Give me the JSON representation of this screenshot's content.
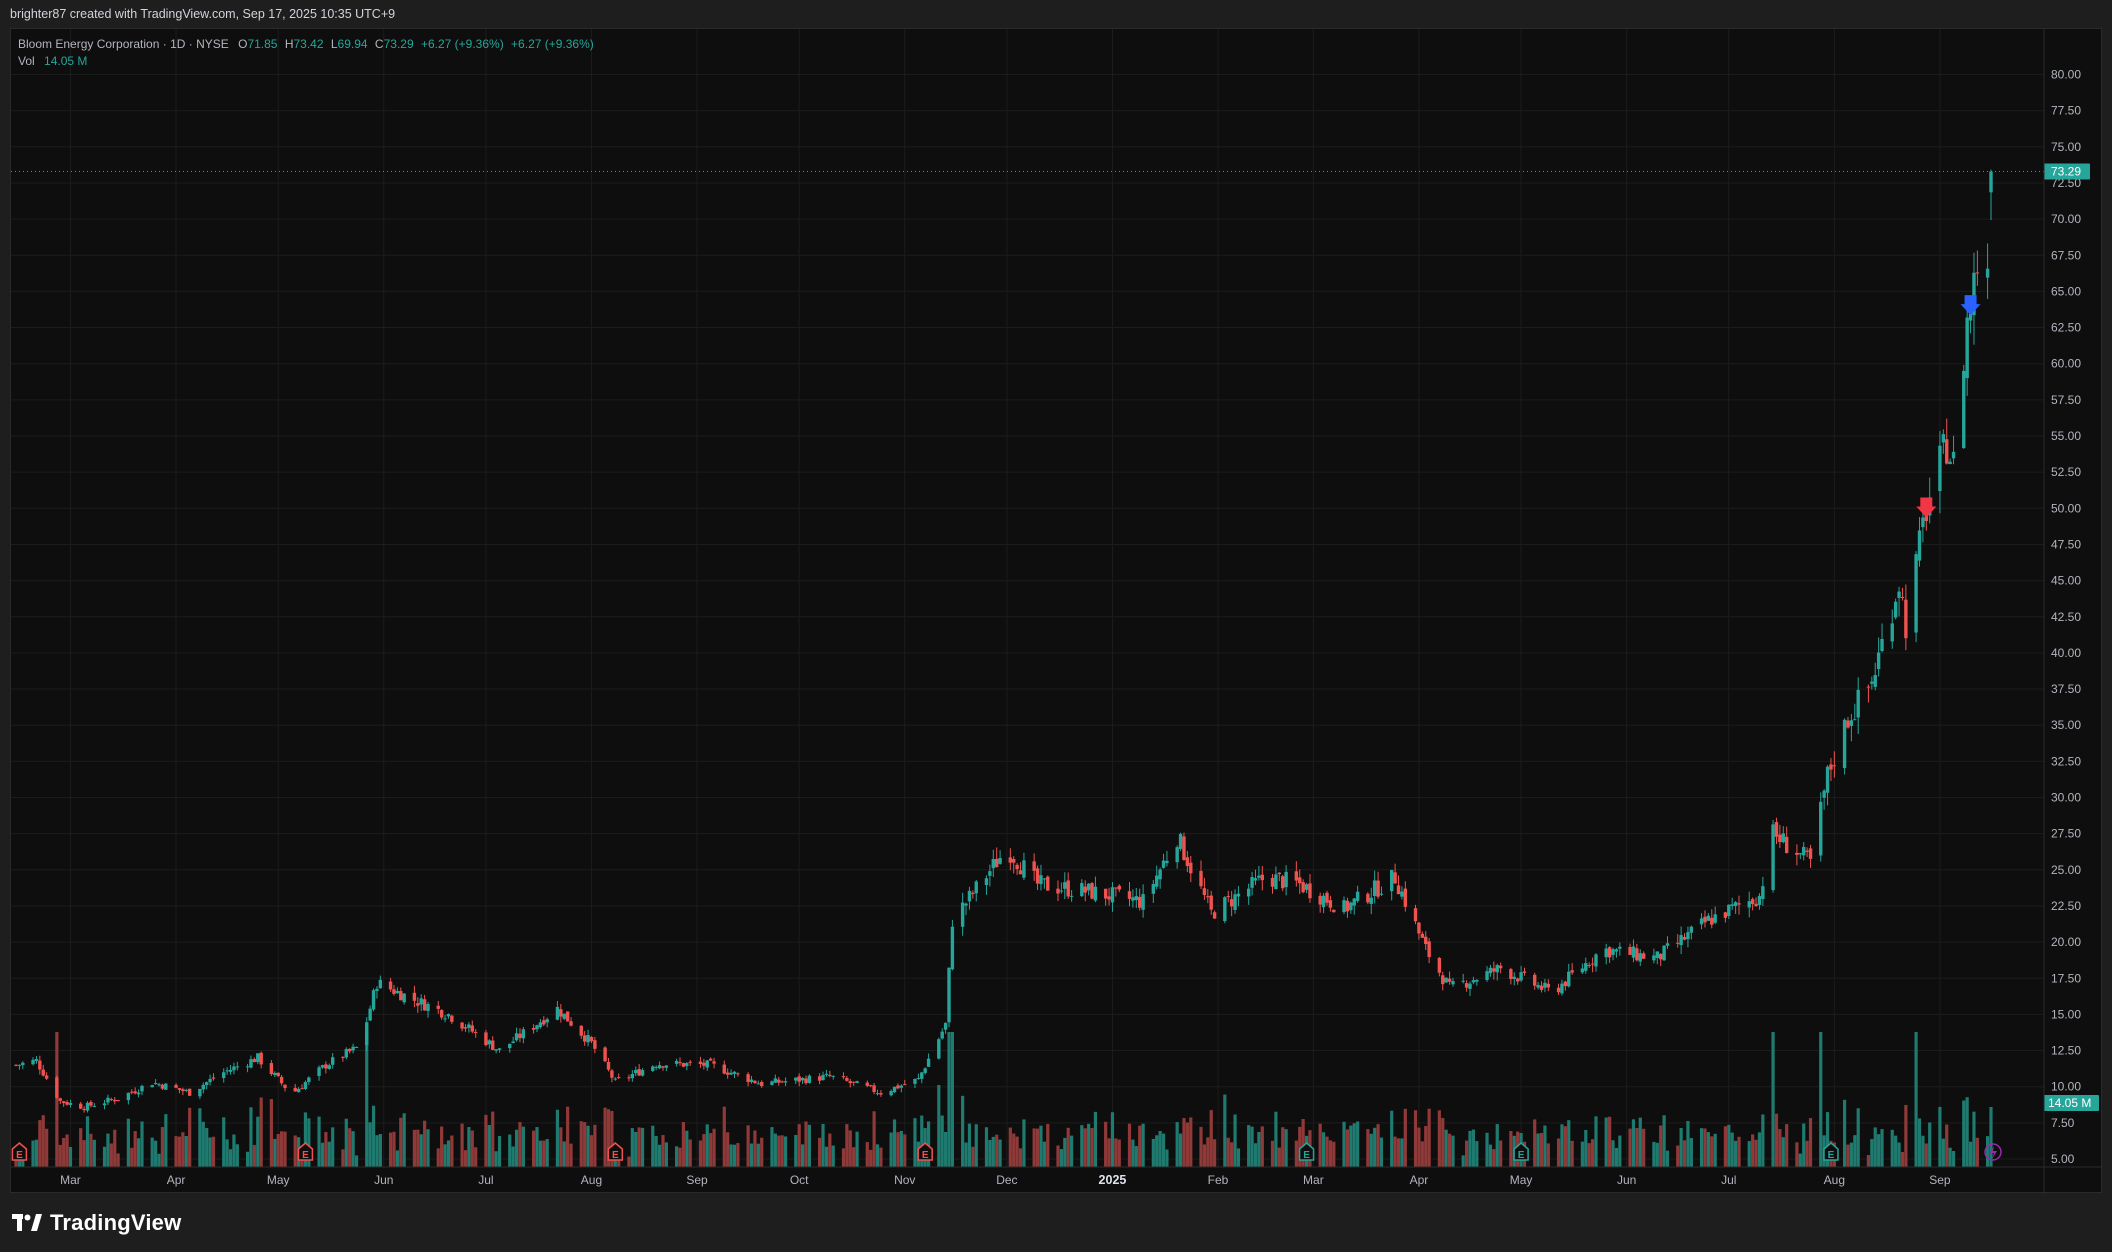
{
  "credit": "brighter87 created with TradingView.com, Sep 17, 2025 10:35 UTC+9",
  "legend": {
    "symbol": "Bloom Energy Corporation · 1D · NYSE",
    "o_label": "O",
    "o_value": "71.85",
    "h_label": "H",
    "h_value": "73.42",
    "l_label": "L",
    "l_value": "69.94",
    "c_label": "C",
    "c_value": "73.29",
    "change": "+6.27 (+9.36%)",
    "change2": "+6.27 (+9.36%)",
    "vol_label": "Vol",
    "vol_value": "14.05 M"
  },
  "logo": "TradingView",
  "colors": {
    "up": "#26a69a",
    "down": "#ef5350",
    "up_volume": "#1f7a6f",
    "down_volume": "#8f3a38",
    "price_tag": "#26a69a",
    "signal_down": "#f23645",
    "signal_blue": "#2962ff",
    "background": "#0e0e0e",
    "grid": "#1c1c1c"
  },
  "chart_data": {
    "type": "candlestick",
    "title": "Bloom Energy Corporation · 1D · NYSE",
    "interval": "1D",
    "y_ticks": [
      "80.00",
      "77.50",
      "75.00",
      "72.50",
      "70.00",
      "67.50",
      "65.00",
      "62.50",
      "60.00",
      "57.50",
      "55.00",
      "52.50",
      "50.00",
      "47.50",
      "45.00",
      "42.50",
      "40.00",
      "37.50",
      "35.00",
      "32.50",
      "30.00",
      "27.50",
      "25.00",
      "22.50",
      "20.00",
      "17.50",
      "15.00",
      "12.50",
      "10.00",
      "7.50",
      "5.00"
    ],
    "ylim": [
      2.5,
      81
    ],
    "x_labels": [
      {
        "label": "Mar",
        "date": "2024-03"
      },
      {
        "label": "Apr",
        "date": "2024-04"
      },
      {
        "label": "May",
        "date": "2024-05"
      },
      {
        "label": "Jun",
        "date": "2024-06"
      },
      {
        "label": "Jul",
        "date": "2024-07"
      },
      {
        "label": "Aug",
        "date": "2024-08"
      },
      {
        "label": "Sep",
        "date": "2024-09"
      },
      {
        "label": "Oct",
        "date": "2024-10"
      },
      {
        "label": "Nov",
        "date": "2024-11"
      },
      {
        "label": "Dec",
        "date": "2024-12"
      },
      {
        "label": "2025",
        "date": "2025-01",
        "bold": true
      },
      {
        "label": "Feb",
        "date": "2025-02"
      },
      {
        "label": "Mar",
        "date": "2025-03"
      },
      {
        "label": "Apr",
        "date": "2025-04"
      },
      {
        "label": "May",
        "date": "2025-05"
      },
      {
        "label": "Jun",
        "date": "2025-06"
      },
      {
        "label": "Jul",
        "date": "2025-07"
      },
      {
        "label": "Aug",
        "date": "2025-08"
      },
      {
        "label": "Sep",
        "date": "2025-09"
      }
    ],
    "last_price": "73.29",
    "last_volume": "14.05 M",
    "close_path": [
      {
        "date": "2024-02-14",
        "close": 11.5
      },
      {
        "date": "2024-02-20",
        "close": 11.8
      },
      {
        "date": "2024-02-27",
        "close": 9.0
      },
      {
        "date": "2024-03-05",
        "close": 8.6
      },
      {
        "date": "2024-03-15",
        "close": 9.2
      },
      {
        "date": "2024-03-25",
        "close": 10.3
      },
      {
        "date": "2024-04-05",
        "close": 9.6
      },
      {
        "date": "2024-04-15",
        "close": 11.0
      },
      {
        "date": "2024-04-25",
        "close": 12.0
      },
      {
        "date": "2024-05-05",
        "close": 9.5
      },
      {
        "date": "2024-05-15",
        "close": 11.5
      },
      {
        "date": "2024-05-25",
        "close": 12.8
      },
      {
        "date": "2024-05-30",
        "close": 17.2
      },
      {
        "date": "2024-06-10",
        "close": 16.0
      },
      {
        "date": "2024-06-20",
        "close": 15.0
      },
      {
        "date": "2024-07-05",
        "close": 12.5
      },
      {
        "date": "2024-07-15",
        "close": 14.2
      },
      {
        "date": "2024-07-22",
        "close": 15.4
      },
      {
        "date": "2024-08-01",
        "close": 13.0
      },
      {
        "date": "2024-08-08",
        "close": 10.3
      },
      {
        "date": "2024-08-20",
        "close": 11.6
      },
      {
        "date": "2024-09-05",
        "close": 11.5
      },
      {
        "date": "2024-09-20",
        "close": 10.2
      },
      {
        "date": "2024-10-10",
        "close": 10.7
      },
      {
        "date": "2024-10-25",
        "close": 9.6
      },
      {
        "date": "2024-11-05",
        "close": 10.5
      },
      {
        "date": "2024-11-13",
        "close": 14.3
      },
      {
        "date": "2024-11-15",
        "close": 21.5
      },
      {
        "date": "2024-12-01",
        "close": 26.5
      },
      {
        "date": "2024-12-10",
        "close": 24.0
      },
      {
        "date": "2024-12-25",
        "close": 23.5
      },
      {
        "date": "2025-01-10",
        "close": 22.8
      },
      {
        "date": "2025-01-20",
        "close": 27.3
      },
      {
        "date": "2025-01-30",
        "close": 22.0
      },
      {
        "date": "2025-02-15",
        "close": 24.5
      },
      {
        "date": "2025-02-25",
        "close": 24.0
      },
      {
        "date": "2025-03-10",
        "close": 22.3
      },
      {
        "date": "2025-03-25",
        "close": 24.5
      },
      {
        "date": "2025-04-03",
        "close": 19.5
      },
      {
        "date": "2025-04-10",
        "close": 16.8
      },
      {
        "date": "2025-04-25",
        "close": 18.2
      },
      {
        "date": "2025-05-10",
        "close": 16.5
      },
      {
        "date": "2025-05-25",
        "close": 19.5
      },
      {
        "date": "2025-06-10",
        "close": 18.9
      },
      {
        "date": "2025-06-25",
        "close": 21.5
      },
      {
        "date": "2025-07-10",
        "close": 23.2
      },
      {
        "date": "2025-07-14",
        "close": 27.5
      },
      {
        "date": "2025-07-25",
        "close": 25.5
      },
      {
        "date": "2025-07-30",
        "close": 31.5
      },
      {
        "date": "2025-08-05",
        "close": 35.5
      },
      {
        "date": "2025-08-12",
        "close": 38.0
      },
      {
        "date": "2025-08-20",
        "close": 45.0
      },
      {
        "date": "2025-08-22",
        "close": 42.0
      },
      {
        "date": "2025-08-28",
        "close": 50.0
      },
      {
        "date": "2025-09-03",
        "close": 54.5
      },
      {
        "date": "2025-09-05",
        "close": 53.0
      },
      {
        "date": "2025-09-09",
        "close": 63.0
      },
      {
        "date": "2025-09-12",
        "close": 67.0
      },
      {
        "date": "2025-09-15",
        "close": 67.0
      },
      {
        "date": "2025-09-16",
        "close": 73.29
      }
    ],
    "signals": [
      {
        "date": "2025-08-28",
        "type": "down-arrow",
        "price": 49.5,
        "color": "#f23645"
      },
      {
        "date": "2025-09-10",
        "type": "down-arrow",
        "price": 63.5,
        "color": "#2962ff"
      }
    ],
    "earnings_markers": [
      {
        "date": "2024-02-15"
      },
      {
        "date": "2024-05-09"
      },
      {
        "date": "2024-08-08"
      },
      {
        "date": "2024-11-07"
      },
      {
        "date": "2025-02-27"
      },
      {
        "date": "2025-05-01"
      },
      {
        "date": "2025-07-31"
      }
    ]
  }
}
